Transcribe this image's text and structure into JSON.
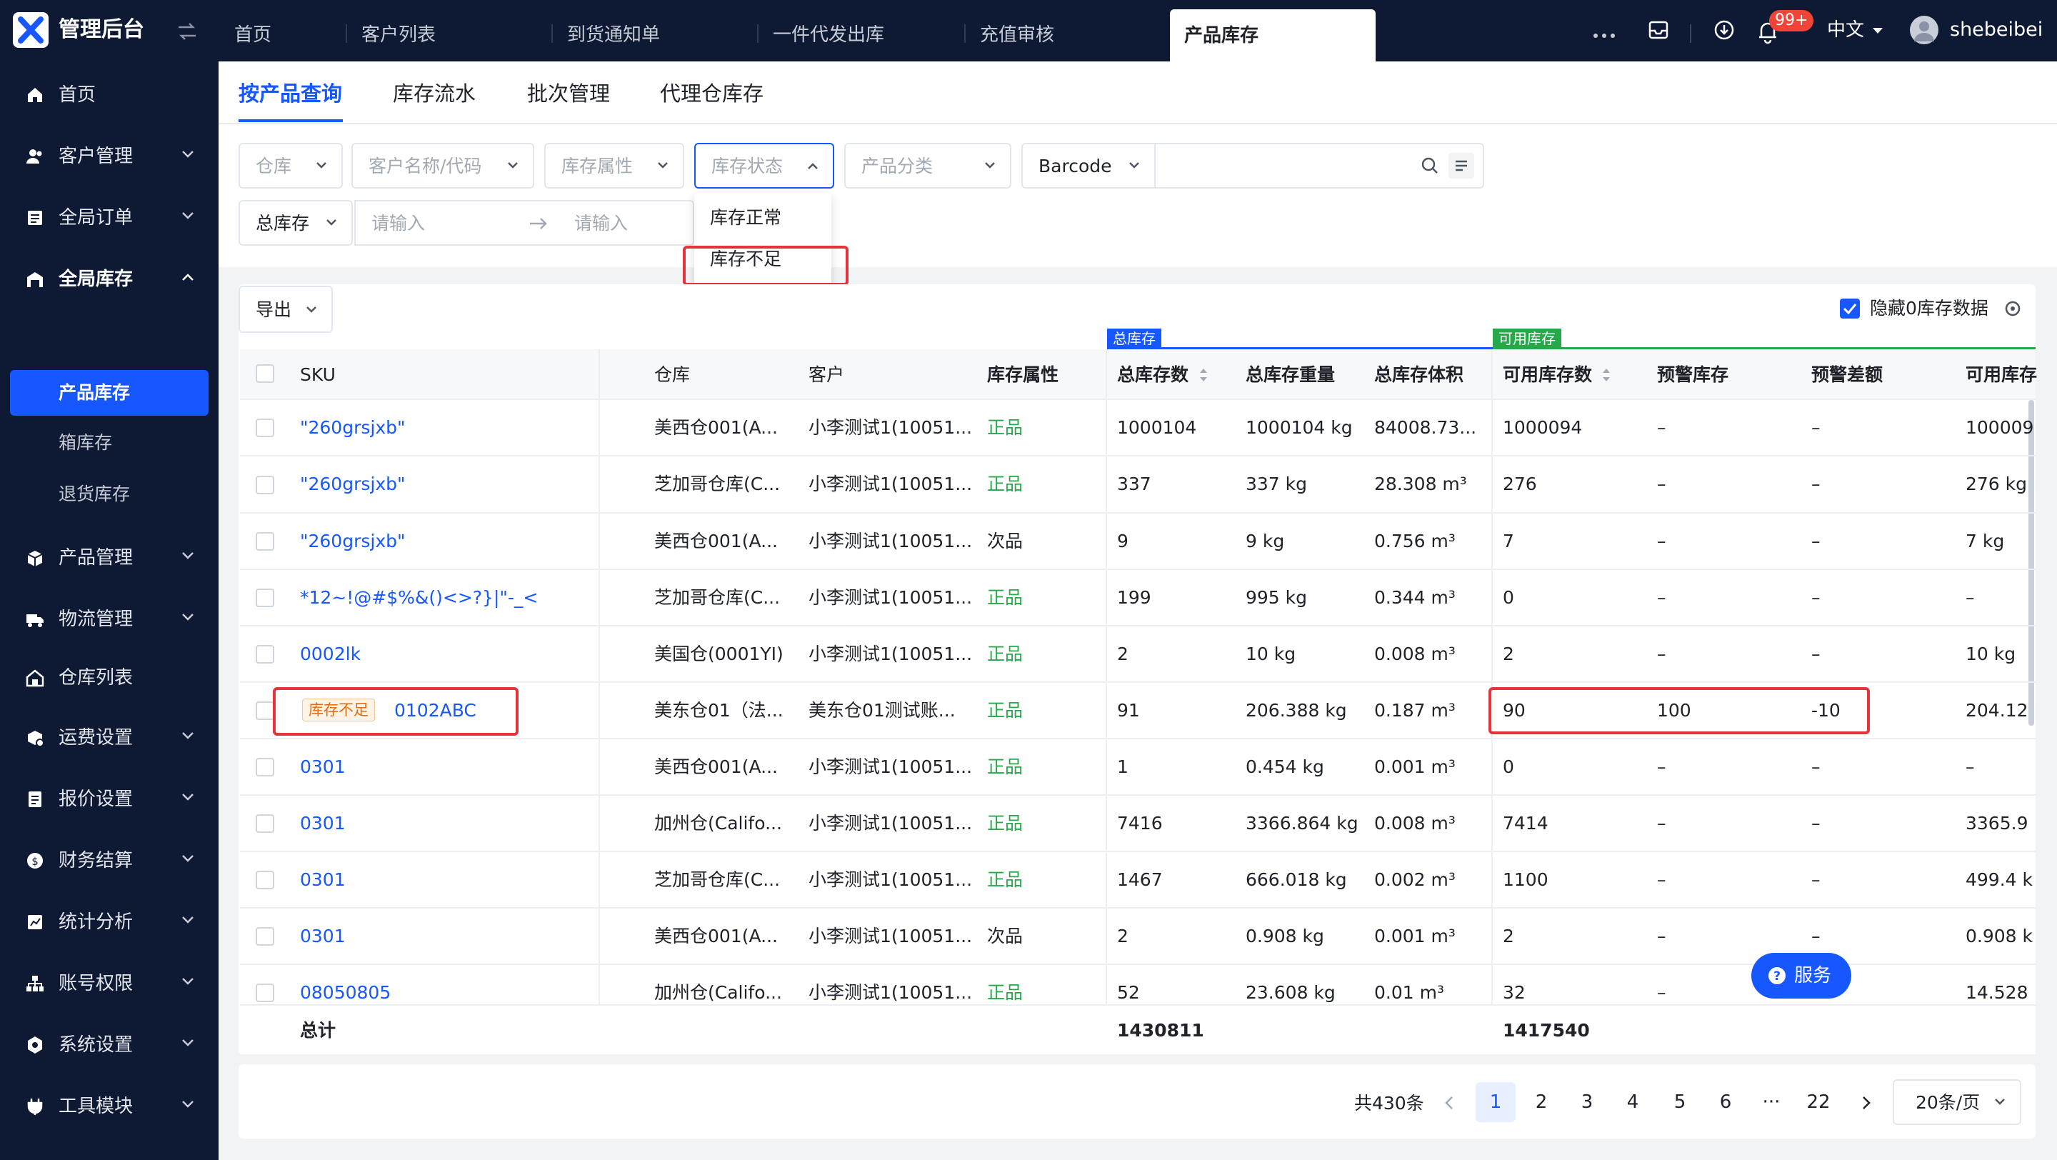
{
  "app": {
    "title": "管理后台"
  },
  "nav_tabs": [
    "首页",
    "客户列表",
    "到货通知单",
    "一件代发出库",
    "充值审核"
  ],
  "active_nav_tab": "产品库存",
  "header": {
    "badge": "99+",
    "language": "中文",
    "username": "shebeibei"
  },
  "sidebar": {
    "items": [
      "首页",
      "客户管理",
      "全局订单",
      "全局库存",
      "产品管理",
      "物流管理",
      "仓库列表",
      "运费设置",
      "报价设置",
      "财务结算",
      "统计分析",
      "账号权限",
      "系统设置",
      "工具模块"
    ],
    "sub_items": [
      "产品库存",
      "箱库存",
      "退货库存"
    ]
  },
  "sub_tabs": [
    "按产品查询",
    "库存流水",
    "批次管理",
    "代理仓库存"
  ],
  "filters": {
    "warehouse": "仓库",
    "customer": "客户名称/代码",
    "attribute": "库存属性",
    "status": "库存状态",
    "category": "产品分类",
    "barcode": "Barcode",
    "total_stock": "总库存",
    "min_placeholder": "请输入",
    "max_placeholder": "请输入"
  },
  "status_dropdown": [
    "库存正常",
    "库存不足"
  ],
  "toolbar": {
    "export": "导出",
    "hide_zero": "隐藏0库存数据"
  },
  "groups": {
    "total": "总库存",
    "available": "可用库存"
  },
  "table": {
    "headers": [
      "SKU",
      "仓库",
      "客户",
      "库存属性",
      "总库存数",
      "总库存重量",
      "总库存体积",
      "可用库存数",
      "预警库存",
      "预警差额",
      "可用库存"
    ],
    "rows": [
      {
        "sku": "\"260grsjxb\"",
        "wh": "美西仓001(A...",
        "cust": "小李测试1(10051...",
        "attr": "正品",
        "qty": "1000104",
        "wt": "1000104 kg",
        "vol": "84008.73...",
        "avail": "1000094",
        "warn": "–",
        "diff": "–",
        "aw": "100009"
      },
      {
        "sku": "\"260grsjxb\"",
        "wh": "芝加哥仓库(C...",
        "cust": "小李测试1(10051...",
        "attr": "正品",
        "qty": "337",
        "wt": "337 kg",
        "vol": "28.308 m³",
        "avail": "276",
        "warn": "–",
        "diff": "–",
        "aw": "276 kg"
      },
      {
        "sku": "\"260grsjxb\"",
        "wh": "美西仓001(A...",
        "cust": "小李测试1(10051...",
        "attr": "次品",
        "qty": "9",
        "wt": "9 kg",
        "vol": "0.756 m³",
        "avail": "7",
        "warn": "–",
        "diff": "–",
        "aw": "7 kg"
      },
      {
        "sku": "*12~!@#$%&()<>?}|\"-_<",
        "wh": "芝加哥仓库(C...",
        "cust": "小李测试1(10051...",
        "attr": "正品",
        "qty": "199",
        "wt": "995 kg",
        "vol": "0.344 m³",
        "avail": "0",
        "warn": "–",
        "diff": "–",
        "aw": "–"
      },
      {
        "sku": "0002lk",
        "wh": "美国仓(0001YI)",
        "cust": "小李测试1(10051...",
        "attr": "正品",
        "qty": "2",
        "wt": "10 kg",
        "vol": "0.008 m³",
        "avail": "2",
        "warn": "–",
        "diff": "–",
        "aw": "10 kg"
      },
      {
        "sku": "0102ABC",
        "wh": "美东仓01（法...",
        "cust": "美东仓01测试账...",
        "attr": "正品",
        "qty": "91",
        "wt": "206.388 kg",
        "vol": "0.187 m³",
        "avail": "90",
        "warn": "100",
        "diff": "-10",
        "aw": "204.12",
        "flag": "库存不足"
      },
      {
        "sku": "0301",
        "wh": "美西仓001(A...",
        "cust": "小李测试1(10051...",
        "attr": "正品",
        "qty": "1",
        "wt": "0.454 kg",
        "vol": "0.001 m³",
        "avail": "0",
        "warn": "–",
        "diff": "–",
        "aw": "–"
      },
      {
        "sku": "0301",
        "wh": "加州仓(Califo...",
        "cust": "小李测试1(10051...",
        "attr": "正品",
        "qty": "7416",
        "wt": "3366.864 kg",
        "vol": "0.008 m³",
        "avail": "7414",
        "warn": "–",
        "diff": "–",
        "aw": "3365.9"
      },
      {
        "sku": "0301",
        "wh": "芝加哥仓库(C...",
        "cust": "小李测试1(10051...",
        "attr": "正品",
        "qty": "1467",
        "wt": "666.018 kg",
        "vol": "0.002 m³",
        "avail": "1100",
        "warn": "–",
        "diff": "–",
        "aw": "499.4 k"
      },
      {
        "sku": "0301",
        "wh": "美西仓001(A...",
        "cust": "小李测试1(10051...",
        "attr": "次品",
        "qty": "2",
        "wt": "0.908 kg",
        "vol": "0.001 m³",
        "avail": "2",
        "warn": "–",
        "diff": "–",
        "aw": "0.908 k"
      },
      {
        "sku": "08050805",
        "wh": "加州仓(Califo...",
        "cust": "小李测试1(10051...",
        "attr": "正品",
        "qty": "52",
        "wt": "23.608 kg",
        "vol": "0.01 m³",
        "avail": "32",
        "warn": "–",
        "diff": "–",
        "aw": "14.528"
      }
    ],
    "total_label": "总计",
    "total_qty": "1430811",
    "total_avail": "1417540"
  },
  "pagination": {
    "total": "共430条",
    "pages": [
      "1",
      "2",
      "3",
      "4",
      "5",
      "6",
      "···",
      "22"
    ],
    "page_size": "20条/页"
  },
  "service_label": "服务",
  "colors": {
    "primary": "#1657ff",
    "dark_nav": "#0e1934",
    "highlight": "#e5333c",
    "good": "#27a94b"
  }
}
